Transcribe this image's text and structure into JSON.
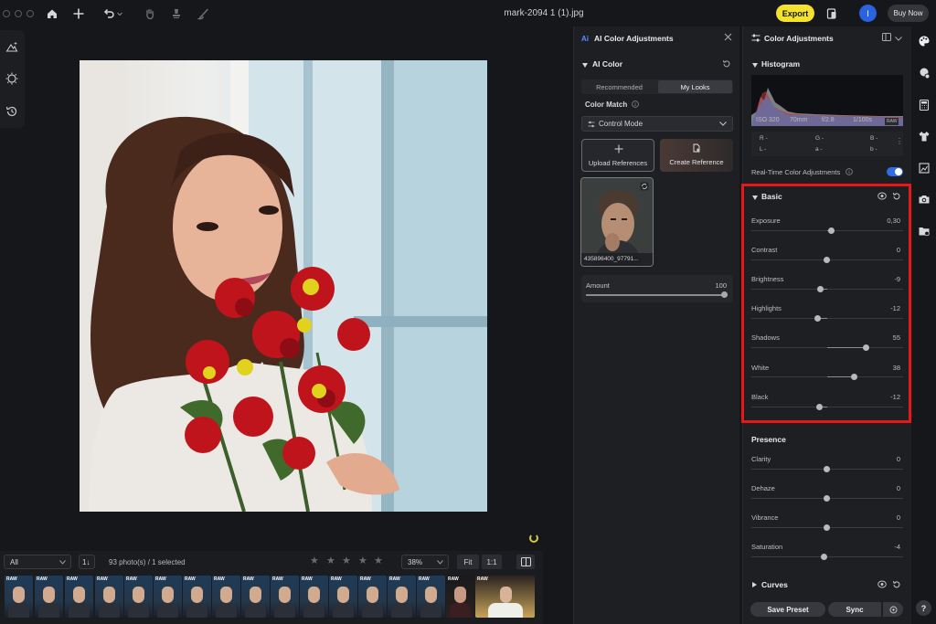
{
  "window": {
    "title": "mark-2094 1 (1).jpg"
  },
  "topbar": {
    "export_label": "Export",
    "avatar_initial": "I",
    "buy_now_label": "Buy Now"
  },
  "filter_bar": {
    "filter_value": "All",
    "sort_label": "1↓",
    "photo_count": "93 photo(s) / 1 selected",
    "rating_stars": 5,
    "zoom_value": "38%",
    "fit_label": "Fit",
    "one_to_one_label": "1:1"
  },
  "filmstrip": {
    "badge_label": "RAW",
    "thumbnail_count": 17
  },
  "ai_panel": {
    "title": "AI Color Adjustments",
    "section_title": "AI Color",
    "tabs": [
      {
        "label": "Recommended",
        "active": false
      },
      {
        "label": "My Looks",
        "active": true
      }
    ],
    "color_match_label": "Color Match",
    "mode_value": "Control Mode",
    "upload_label": "Upload References",
    "create_label": "Create Reference",
    "reference_name": "435896400_97791...",
    "amount_label": "Amount",
    "amount_value": "100"
  },
  "color_adjustments": {
    "title": "Color Adjustments",
    "histogram_title": "Histogram",
    "exif": {
      "iso": "ISO 320",
      "focal": "70mm",
      "aperture": "f/2.8",
      "shutter": "1/100s",
      "format": "RAW"
    },
    "readouts": {
      "r": "R -",
      "g": "G -",
      "b": "B -",
      "l": "L -",
      "a": "a -",
      "b2": "b -"
    },
    "realtime_label": "Real-Time Color Adjustments",
    "realtime_on": true,
    "basic": {
      "title": "Basic",
      "sliders": [
        {
          "label": "Exposure",
          "value": "0,30"
        },
        {
          "label": "Contrast",
          "value": "0"
        },
        {
          "label": "Brightness",
          "value": "-9"
        },
        {
          "label": "Highlights",
          "value": "-12"
        },
        {
          "label": "Shadows",
          "value": "55"
        },
        {
          "label": "White",
          "value": "38"
        },
        {
          "label": "Black",
          "value": "-12"
        }
      ]
    },
    "presence": {
      "title": "Presence",
      "sliders": [
        {
          "label": "Clarity",
          "value": "0"
        },
        {
          "label": "Dehaze",
          "value": "0"
        },
        {
          "label": "Vibrance",
          "value": "0"
        },
        {
          "label": "Saturation",
          "value": "-4"
        }
      ]
    },
    "curves_title": "Curves",
    "save_preset_label": "Save Preset",
    "sync_label": "Sync"
  },
  "help_label": "?",
  "colors": {
    "export_yellow": "#f5e22d",
    "highlight_red": "#e81818",
    "toggle_blue": "#2e6de6",
    "avatar_blue": "#2a62e0"
  }
}
